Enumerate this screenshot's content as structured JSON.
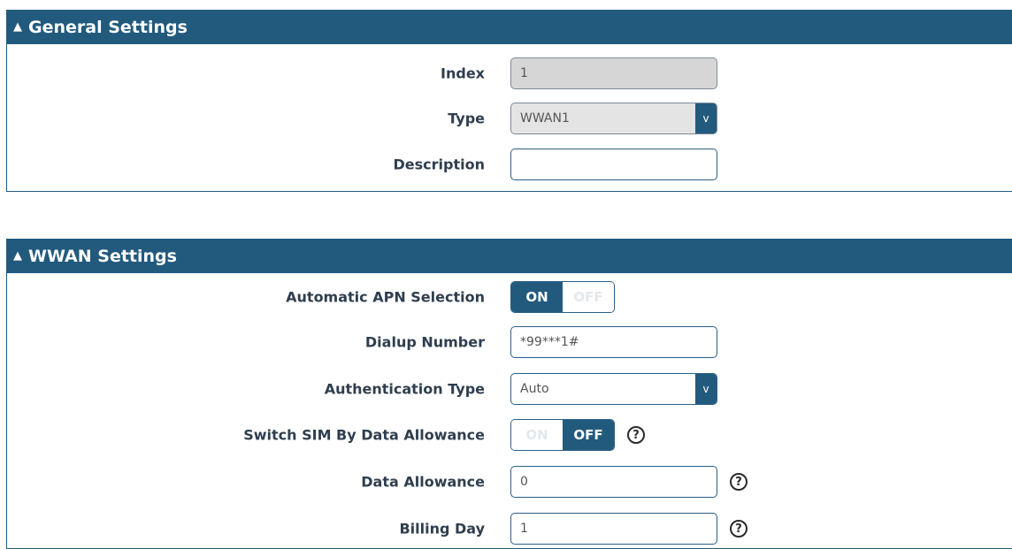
{
  "general": {
    "title": "General Settings",
    "index_label": "Index",
    "index_value": "1",
    "type_label": "Type",
    "type_value": "WWAN1",
    "description_label": "Description",
    "description_value": ""
  },
  "wwan": {
    "title": "WWAN Settings",
    "auto_apn_label": "Automatic APN Selection",
    "auto_apn_on": "ON",
    "auto_apn_off": "OFF",
    "auto_apn_state": "on",
    "dialup_label": "Dialup Number",
    "dialup_value": "*99***1#",
    "auth_label": "Authentication Type",
    "auth_value": "Auto",
    "switch_sim_label": "Switch SIM By Data Allowance",
    "switch_sim_on": "ON",
    "switch_sim_off": "OFF",
    "switch_sim_state": "off",
    "data_allowance_label": "Data Allowance",
    "data_allowance_value": "0",
    "billing_day_label": "Billing Day",
    "billing_day_value": "1"
  },
  "icons": {
    "caret": "chevron-up-icon",
    "select_arrow": "chevron-down-icon",
    "help": "help-icon"
  },
  "colors": {
    "header_bg": "#225a7e",
    "toggle_active": "#225a7e"
  }
}
